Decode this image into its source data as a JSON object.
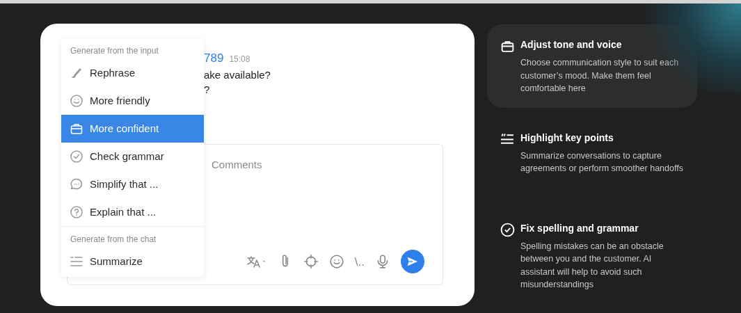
{
  "chat": {
    "author": "789",
    "time": "15:08",
    "lines": [
      "ake available?",
      "?"
    ]
  },
  "composer": {
    "placeholder": "Comments",
    "toolbar": [
      "\\.."
    ]
  },
  "menu": {
    "sections": [
      {
        "heading": "Generate from the input",
        "items": [
          {
            "label": "Rephrase",
            "selected": false
          },
          {
            "label": "More friendly",
            "selected": false
          },
          {
            "label": "More confident",
            "selected": true
          },
          {
            "label": "Check grammar",
            "selected": false
          },
          {
            "label": "Simplify that ...",
            "selected": false
          },
          {
            "label": "Explain that ...",
            "selected": false
          }
        ]
      },
      {
        "heading": "Generate from the chat",
        "items": [
          {
            "label": "Summarize",
            "selected": false
          }
        ]
      }
    ]
  },
  "features": [
    {
      "title": "Adjust tone and voice",
      "description": "Choose communication style to suit each customer’s mood. Make them feel comfortable here",
      "selected": true
    },
    {
      "title": "Highlight key points",
      "description": "Summarize conversations to capture agreements or perform smoother handoffs",
      "selected": false
    },
    {
      "title": "Fix spelling and grammar",
      "description": "Spelling mistakes can be an obstacle between you and the customer. AI assistant will help to avoid such misunderstandings",
      "selected": false
    }
  ]
}
